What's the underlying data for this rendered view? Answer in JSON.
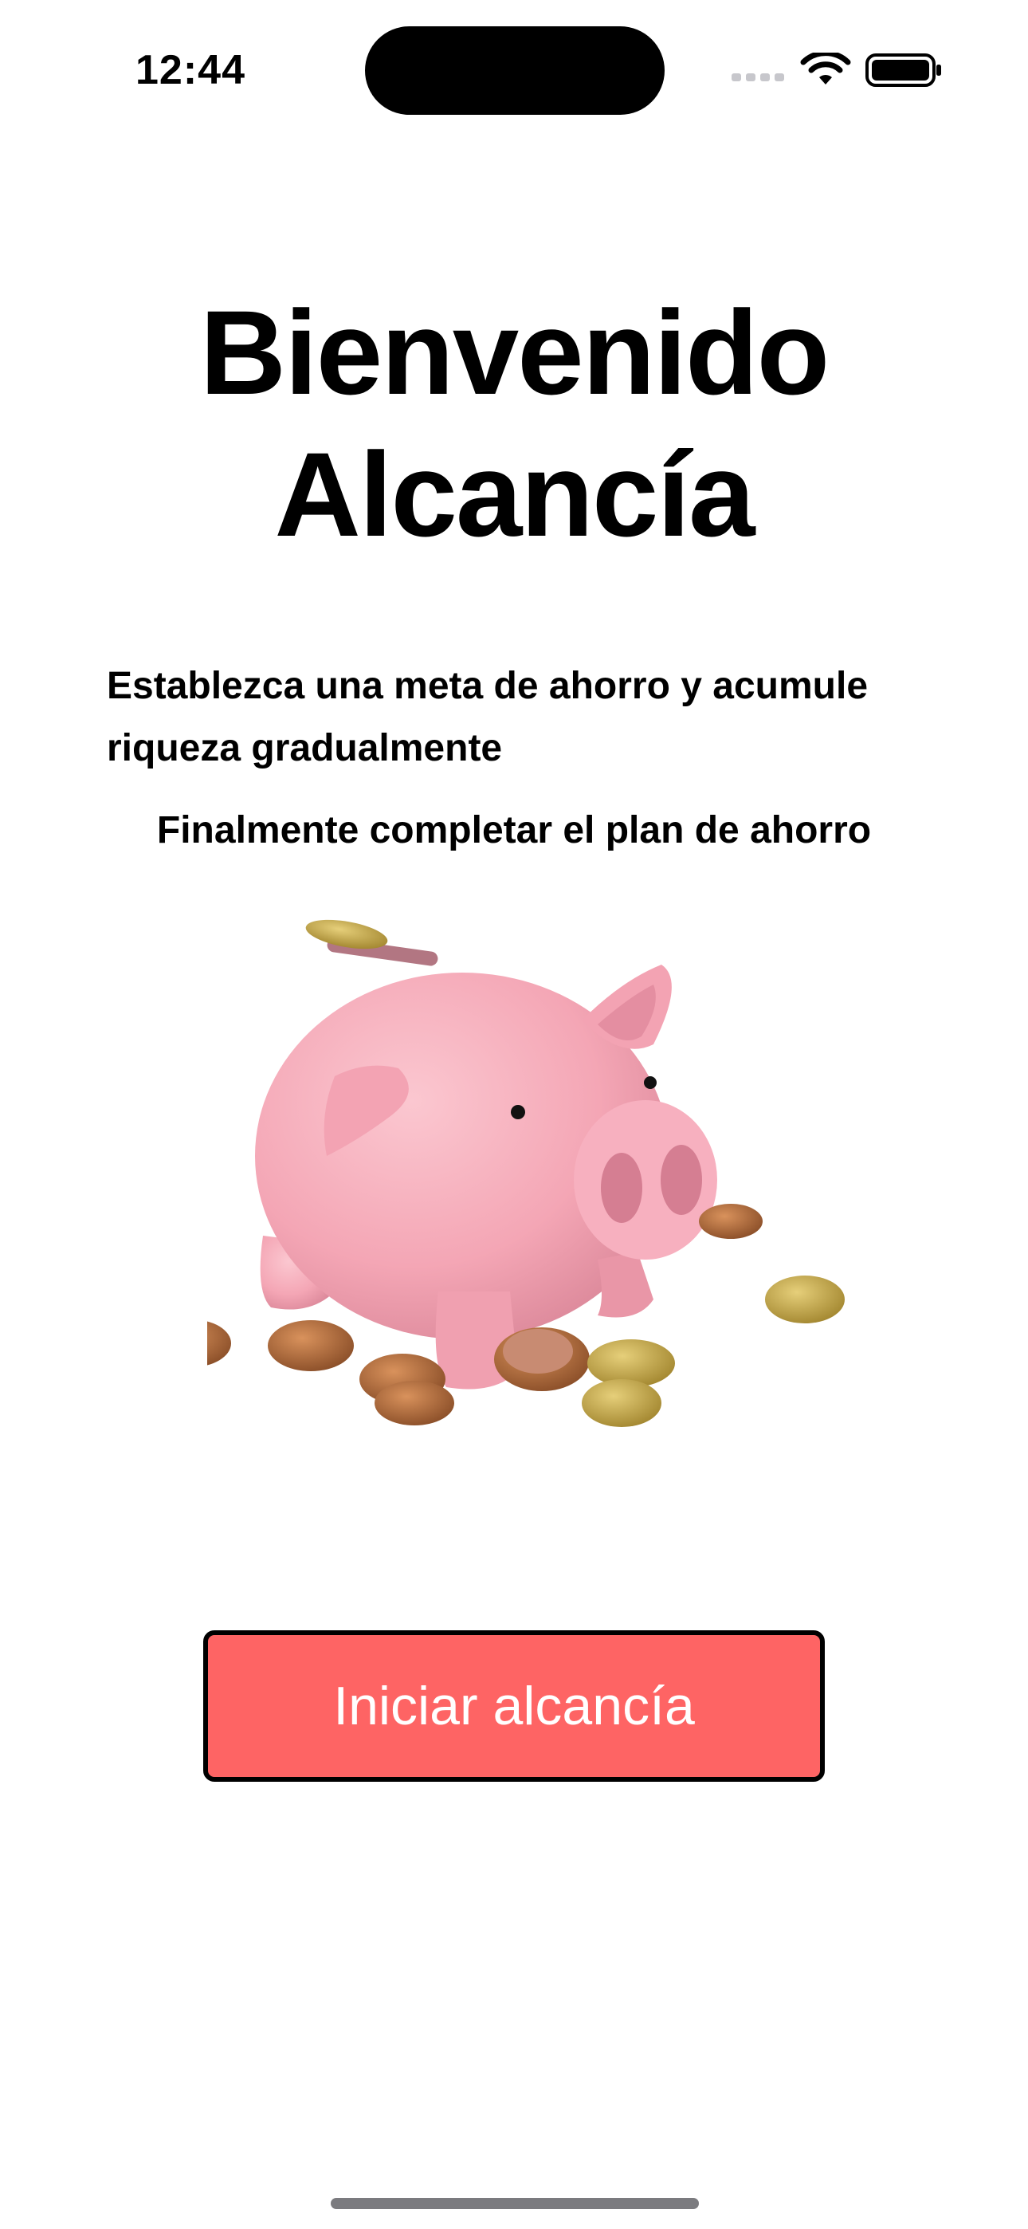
{
  "status_bar": {
    "time": "12:44",
    "icons": [
      "cellular-signal-icon",
      "wifi-icon",
      "battery-icon"
    ]
  },
  "welcome": {
    "title_line1": "Bienvenido",
    "title_line2": "Alcancía",
    "subtitle": "Establezca una meta de ahorro y acumule riqueza gradualmente",
    "subtitle2": "Finalmente completar el plan de ahorro"
  },
  "illustration": {
    "name": "piggy-bank-with-coins",
    "pig_color": "#f4a6b5"
  },
  "actions": {
    "start_label": "Iniciar alcancía",
    "start_color": "#fe6464"
  }
}
